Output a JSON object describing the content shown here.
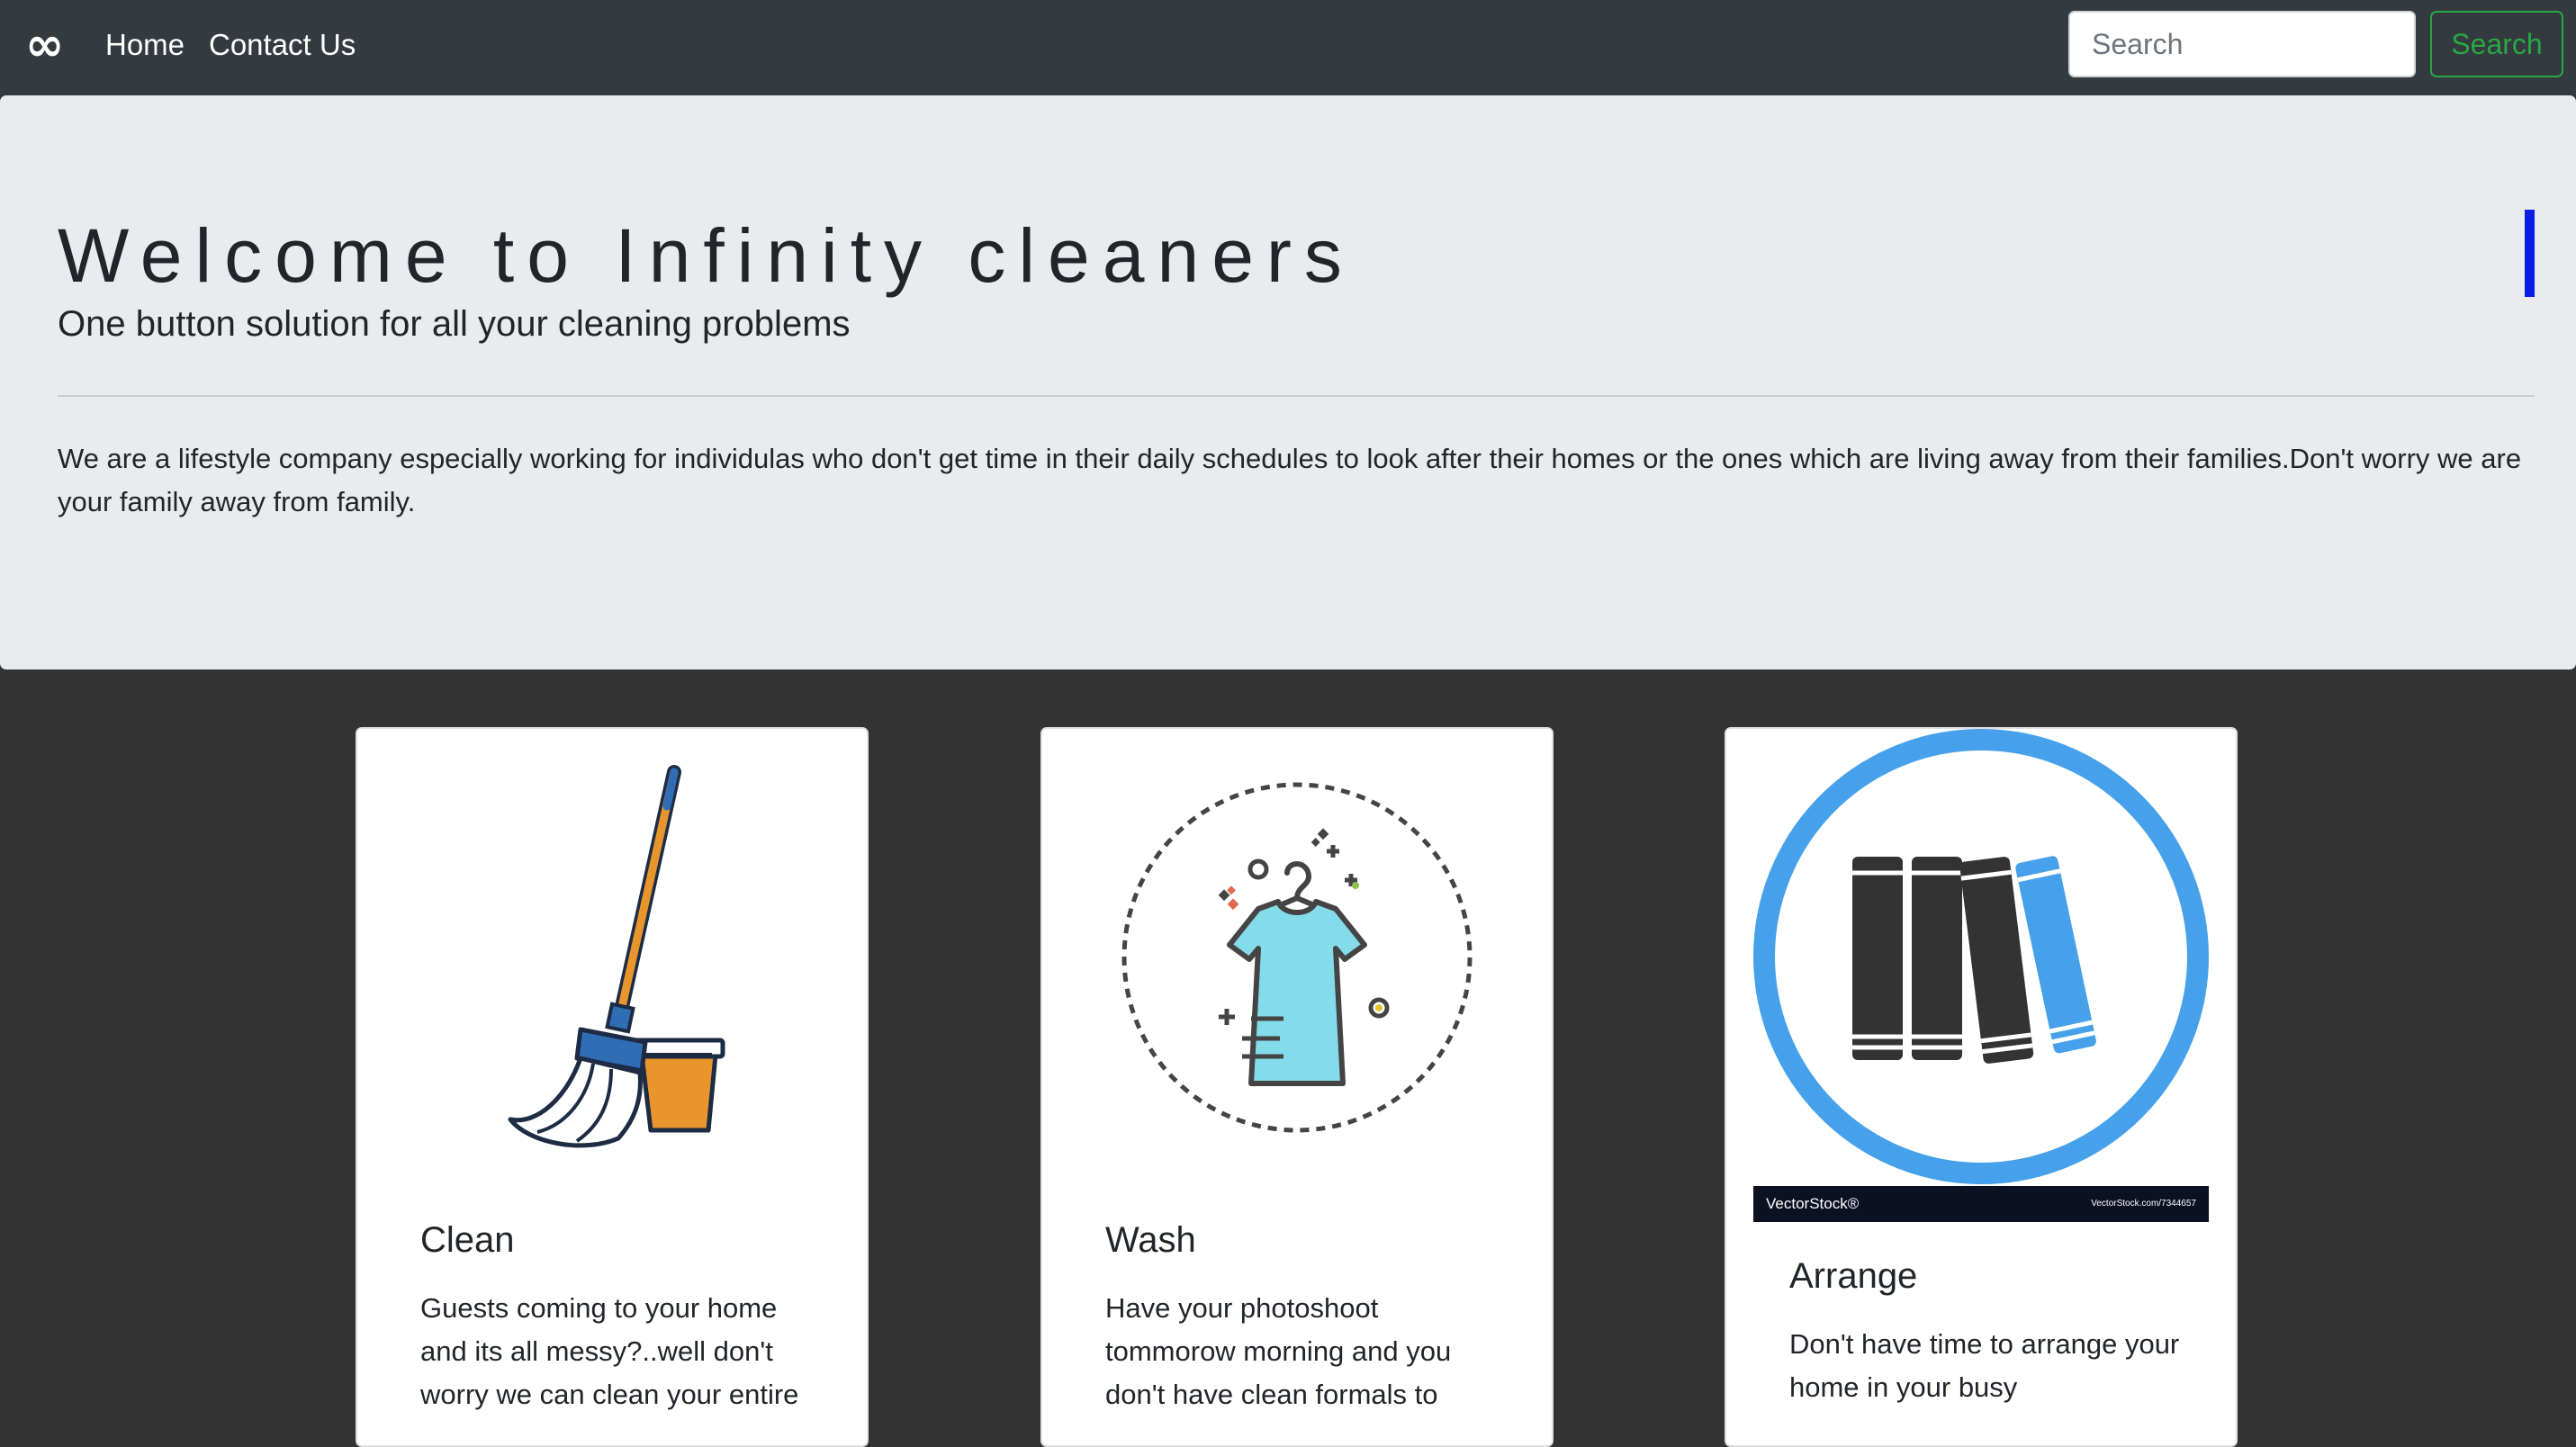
{
  "navbar": {
    "brand": "∞",
    "links": [
      {
        "label": "Home"
      },
      {
        "label": "Contact Us"
      }
    ],
    "search": {
      "placeholder": "Search",
      "button_label": "Search"
    }
  },
  "jumbotron": {
    "title": "Welcome to Infinity cleaners",
    "subtitle": "One button solution for all your cleaning problems",
    "description": "We are a lifestyle company especially working for individulas who don't get time in their daily schedules to look after their homes or the ones which are living away from their families.Don't worry we are your family away from family."
  },
  "cards": [
    {
      "title": "Clean",
      "text": "Guests coming to your home and its all messy?..well don't worry we can clean your entire",
      "image_icon": "mop-bucket-icon"
    },
    {
      "title": "Wash",
      "text": "Have your photoshoot tommorow morning and you don't have clean formals to",
      "image_icon": "clean-shirt-icon"
    },
    {
      "title": "Arrange",
      "text": "Don't have time to arrange your home in your busy",
      "image_icon": "books-icon",
      "watermark": {
        "logo": "VectorStock®",
        "id": "VectorStock.com/7344657"
      }
    }
  ],
  "colors": {
    "navbar_bg": "#343a40",
    "jumbotron_bg": "#e9ecef",
    "page_bg": "#333333",
    "search_button": "#28a745",
    "caret": "#0a1fe6"
  }
}
